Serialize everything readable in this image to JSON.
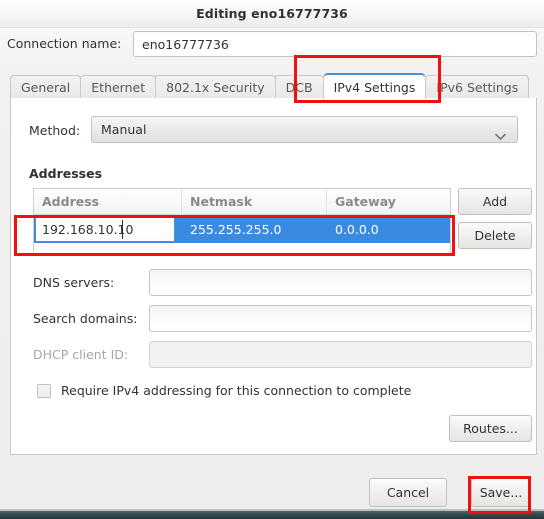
{
  "window": {
    "title": "Editing eno16777736"
  },
  "connection": {
    "label": "Connection name:",
    "value": "eno16777736",
    "placeholder": ""
  },
  "tabs": [
    {
      "label": "General",
      "active": false
    },
    {
      "label": "Ethernet",
      "active": false
    },
    {
      "label": "802.1x Security",
      "active": false
    },
    {
      "label": "DCB",
      "active": false
    },
    {
      "label": "IPv4 Settings",
      "active": true
    },
    {
      "label": "IPv6 Settings",
      "active": false
    }
  ],
  "ipv4": {
    "method": {
      "label": "Method:",
      "selected": "Manual",
      "chevron_icon": "chevron-down-icon"
    },
    "addresses": {
      "section_label": "Addresses",
      "columns": [
        "Address",
        "Netmask",
        "Gateway"
      ],
      "rows": [
        {
          "address": "192.168.10.10",
          "netmask": "255.255.255.0",
          "gateway": "0.0.0.0",
          "selected": true,
          "editing_cell": "address"
        }
      ],
      "add_label": "Add",
      "delete_label": "Delete"
    },
    "dns_servers": {
      "label": "DNS servers:",
      "value": "",
      "disabled": false
    },
    "search_domains": {
      "label": "Search domains:",
      "value": "",
      "disabled": false
    },
    "dhcp_client_id": {
      "label": "DHCP client ID:",
      "value": "",
      "disabled": true
    },
    "require_ipv4": {
      "label": "Require IPv4 addressing for this connection to complete",
      "checked": false
    },
    "routes_label": "Routes..."
  },
  "footer": {
    "cancel_label": "Cancel",
    "save_label": "Save..."
  },
  "colors": {
    "selection_blue": "#3b8ae2",
    "active_tab_accent": "#4a90d9",
    "annotation_red": "#ee1111",
    "disabled_text": "#a6a6a3"
  }
}
